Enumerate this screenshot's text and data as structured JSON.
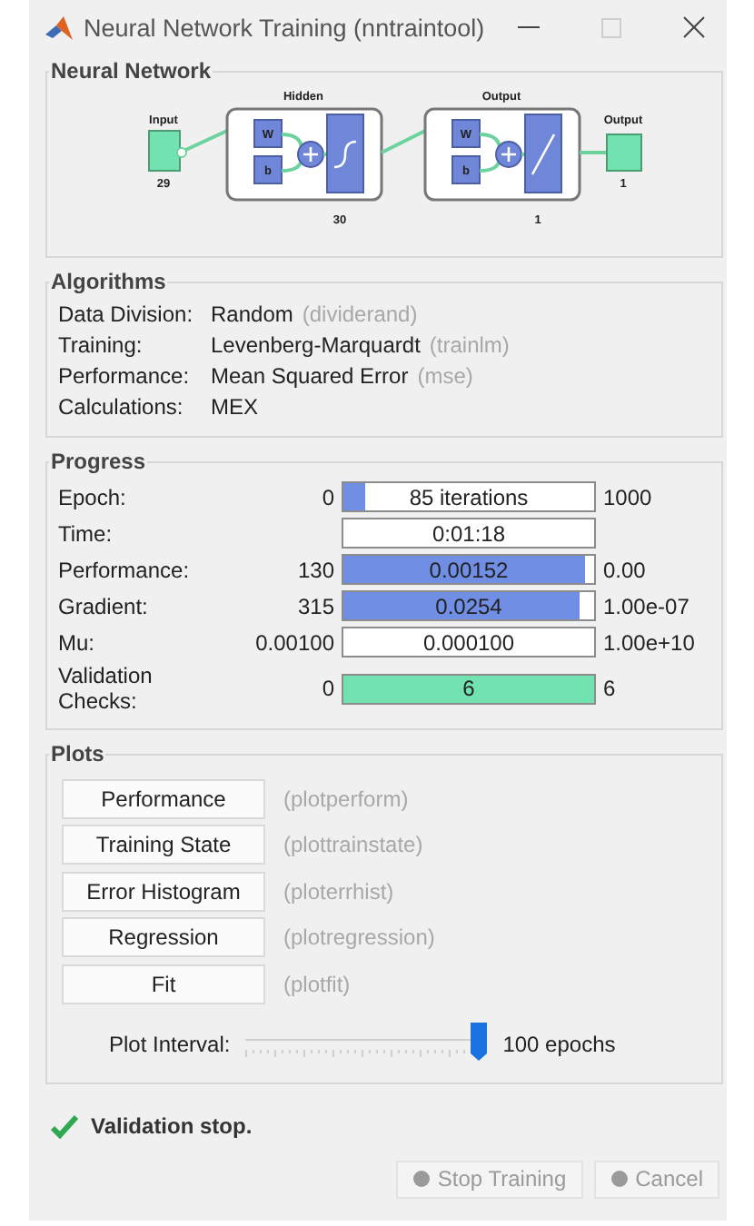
{
  "window": {
    "title": "Neural Network Training (nntraintool)"
  },
  "network": {
    "title": "Neural Network",
    "input": {
      "label": "Input",
      "size": "29"
    },
    "layers": [
      {
        "label": "Hidden",
        "size": "30",
        "weight": "W",
        "bias": "b",
        "kind": "sigmoid"
      },
      {
        "label": "Output",
        "size": "1",
        "weight": "W",
        "bias": "b",
        "kind": "linear"
      }
    ],
    "output": {
      "label": "Output",
      "size": "1"
    }
  },
  "algorithms": {
    "title": "Algorithms",
    "rows": [
      {
        "label": "Data Division:",
        "value": "Random",
        "function": "(dividerand)"
      },
      {
        "label": "Training:",
        "value": "Levenberg-Marquardt",
        "function": "(trainlm)"
      },
      {
        "label": "Performance:",
        "value": "Mean Squared Error",
        "function": "(mse)"
      },
      {
        "label": "Calculations:",
        "value": "MEX"
      }
    ]
  },
  "progress": {
    "title": "Progress",
    "rows": [
      {
        "label": "Epoch:",
        "start": "0",
        "reading": "85 iterations",
        "end": "1000",
        "level": 0.085,
        "color": "#6f8ee4"
      },
      {
        "label": "Time:",
        "reading": "0:01:18"
      },
      {
        "label": "Performance:",
        "start": "130",
        "reading": "0.00152",
        "end": "0.00",
        "level": 0.965,
        "color": "#6f8ee4"
      },
      {
        "label": "Gradient:",
        "start": "315",
        "reading": "0.0254",
        "end": "1.00e-07",
        "level": 0.945,
        "color": "#6f8ee4"
      },
      {
        "label": "Mu:",
        "start": "0.00100",
        "reading": "0.000100",
        "end": "1.00e+10"
      },
      {
        "label": "Validation Checks:",
        "start": "0",
        "reading": "6",
        "end": "6",
        "level": 1,
        "color": "#72e2b0"
      }
    ]
  },
  "plots": {
    "title": "Plots",
    "buttons": [
      {
        "label": "Performance",
        "function": "(plotperform)"
      },
      {
        "label": "Training State",
        "function": "(plottrainstate)"
      },
      {
        "label": "Error Histogram",
        "function": "(ploterrhist)"
      },
      {
        "label": "Regression",
        "function": "(plotregression)"
      },
      {
        "label": "Fit",
        "function": "(plotfit)"
      }
    ],
    "interval": {
      "label": "Plot Interval:",
      "level": 1,
      "reading": "100 epochs"
    }
  },
  "status": {
    "kind": "success",
    "text": "Validation stop."
  },
  "buttons": [
    {
      "label": "Stop Training",
      "disabled": true
    },
    {
      "label": "Cancel",
      "disabled": true
    }
  ]
}
